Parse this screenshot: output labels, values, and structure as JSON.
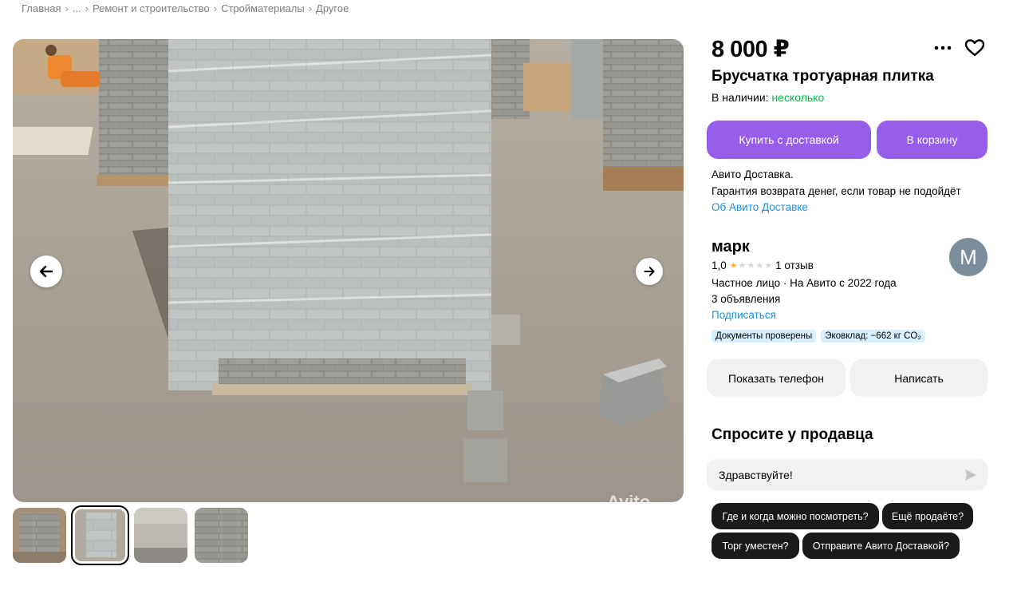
{
  "breadcrumb": [
    "Главная",
    "...",
    "Ремонт и строительство",
    "Стройматериалы",
    "Другое"
  ],
  "breadcrumb_sep": "›",
  "listing": {
    "price": "8 000 ₽",
    "title": "Брусчатка тротуарная плитка",
    "stock_label": "В наличии:",
    "stock_value": "несколько",
    "stock_color": "#02b83f"
  },
  "actions": {
    "buy_with_delivery": "Купить с доставкой",
    "add_to_cart": "В корзину",
    "more_icon": "ellipsis-icon",
    "favorite_icon": "heart-icon"
  },
  "delivery": {
    "line1": "Авито Доставка.",
    "line2": "Гарантия возврата денег, если товар не подойдёт",
    "link": "Об Авито Доставке"
  },
  "seller": {
    "name": "марк",
    "rating_value": "1,0",
    "rating_stars": 1,
    "rating_max": 5,
    "reviews": "1 отзыв",
    "type_since": "Частное лицо · На Авито с 2022 года",
    "ads_count": "3 объявления",
    "subscribe": "Подписаться",
    "avatar_letter": "М",
    "avatar_color": "#7b8e9c"
  },
  "badges": [
    "Документы проверены",
    "Эковклад: −662 кг CO₂"
  ],
  "contact": {
    "show_phone": "Показать телефон",
    "write": "Написать"
  },
  "ask": {
    "title": "Спросите у продавца",
    "input_value": "Здравствуйте!",
    "chips": [
      "Где и когда можно посмотреть?",
      "Ещё продаёте?",
      "Торг уместен?",
      "Отправите Авито Доставкой?"
    ]
  },
  "gallery": {
    "thumbs_count": 4,
    "active_index": 1,
    "watermark": "Avito"
  },
  "colors": {
    "accent": "#965eeb",
    "link": "#1b90e5",
    "badge_bg": "#d7f0ff",
    "chip_bg": "#1a1a1a"
  }
}
